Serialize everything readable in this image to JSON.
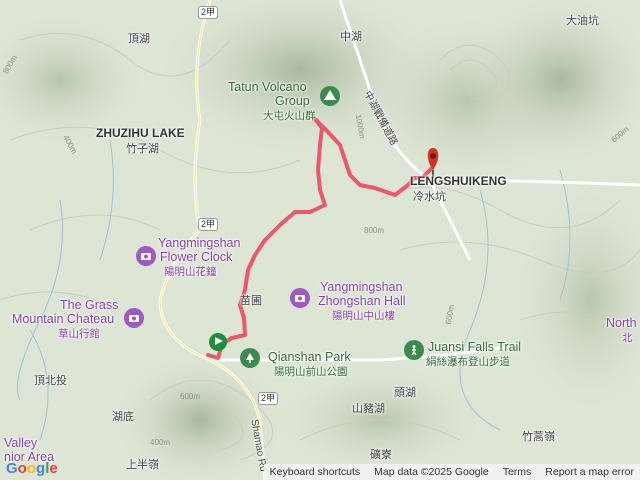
{
  "map": {
    "labels": {
      "zhonghu": "中湖",
      "dayoukeng": "大油坑",
      "dinghu": "頂湖",
      "tatun_en": "Tatun Volcano",
      "tatun_en2": "Group",
      "tatun_zh": "大屯火山群",
      "zhuzihu_en": "ZHUZIHU LAKE",
      "zhuzihu_zh": "竹子湖",
      "lengshuikeng_en": "LENGSHUIKENG",
      "lengshuikeng_zh": "冷水坑",
      "flower_clock_en1": "Yangmingshan",
      "flower_clock_en2": "Flower Clock",
      "flower_clock_zh": "陽明山花鐘",
      "grass_chateau_en1": "The Grass",
      "grass_chateau_en2": "Mountain Chateau",
      "grass_chateau_zh": "草山行館",
      "zhongshan_en1": "Yangmingshan",
      "zhongshan_en2": "Zhongshan Hall",
      "zhongshan_zh": "陽明山中山樓",
      "miaopu": "苗圃",
      "qianshan_en": "Qianshan Park",
      "qianshan_zh": "陽明山前山公園",
      "juansi_en": "Juansi Falls Trail",
      "juansi_zh": "絹絲瀑布登山步道",
      "north_en": "North",
      "north_zh": "北",
      "dingbeitou": "頂北投",
      "toushu": "頭湖",
      "hudi": "湖底",
      "shanzhuhu": "山豬湖",
      "zhusongling": "竹蒿嶺",
      "valley_en1": "Valley",
      "valley_en2": "nior Area",
      "shamao_rd": "Shamao Rd",
      "shangbanling": "上半嶺",
      "kuangliao": "礦寮",
      "zhonghu_road": "中湖戰備道路"
    },
    "route_badges": [
      "2甲",
      "2甲",
      "2甲"
    ],
    "elevations": [
      "800m",
      "400m",
      "600m",
      "800m",
      "600m",
      "400m",
      "1000m",
      "600m"
    ]
  },
  "footer": {
    "keyboard": "Keyboard shortcuts",
    "mapdata": "Map data ©2025 Google",
    "terms": "Terms",
    "report": "Report a map error",
    "logo": "Google"
  },
  "colors": {
    "route": "#f0566a",
    "poi_purple": "#a157c7",
    "poi_green": "#3c8a4d",
    "start_flag": "#1e8e3e",
    "end_pin": "#d93025"
  }
}
